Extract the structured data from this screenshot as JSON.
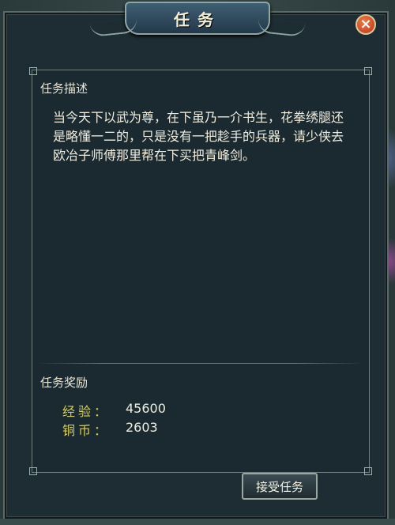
{
  "window": {
    "title": "任务",
    "close_label": "×"
  },
  "description": {
    "heading": "任务描述",
    "text": "当今天下以武为尊，在下虽乃一介书生，花拳绣腿还是略懂一二的，只是没有一把趁手的兵器，请少侠去欧冶子师傅那里帮在下买把青峰剑。"
  },
  "rewards": {
    "heading": "任务奖励",
    "items": [
      {
        "label": "经验：",
        "value": "45600"
      },
      {
        "label": "铜币：",
        "value": "2603"
      }
    ]
  },
  "actions": {
    "accept_label": "接受任务"
  },
  "colors": {
    "reward_label": "#d5cf5a",
    "panel_bg": "#1b2a30",
    "close_button": "#d4502a"
  }
}
